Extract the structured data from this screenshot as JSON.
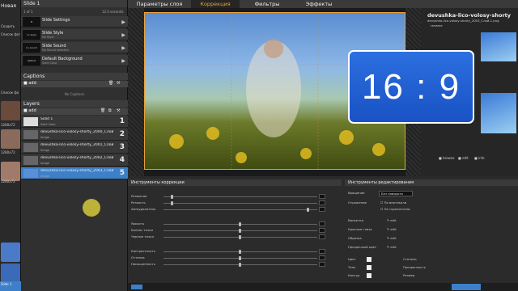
{
  "left_strip": {
    "items": [
      "Новая",
      "Создать",
      "Список фото",
      "Список фо"
    ],
    "thumb_labels": [
      "1280x72",
      "1280x72",
      "1280x72"
    ]
  },
  "slide_panel": {
    "title": "Slide 1",
    "count": "1 of 1",
    "duration": "12.0 seconds",
    "rows": [
      {
        "icon": "",
        "title": "Slide Settings",
        "sub": ""
      },
      {
        "icon": "no style",
        "title": "Slide Style",
        "sub": "No Style"
      },
      {
        "icon": "no sound",
        "title": "Slide Sound",
        "sub": "No Sound selected"
      },
      {
        "icon": "default",
        "title": "Default Background",
        "sub": "Solid Color"
      }
    ],
    "captions_label": "Captions",
    "add_label": "add",
    "no_captions": "No Captions",
    "layers_label": "Layers",
    "layers": [
      {
        "name": "Solid 1",
        "kind": "Solid Color",
        "num": "1"
      },
      {
        "name": "devushka-lico-volosy-shorty_2000_Слой-1.png",
        "kind": "Image",
        "num": "2"
      },
      {
        "name": "devushka-lico-volosy-shorty_2001_Слой-1.png",
        "kind": "Image",
        "num": "3"
      },
      {
        "name": "devushka-lico-volosy-shorty_2002_Слой-1.png",
        "kind": "Image",
        "num": "4"
      },
      {
        "name": "devushka-lico-volosy-shorty_2003_Слой-1.png",
        "kind": "Image",
        "num": "5"
      }
    ]
  },
  "tabs": [
    "Параметры слоя",
    "Коррекция",
    "Фильтры",
    "Эффекты"
  ],
  "props": {
    "title": "devushka-lico-volosy-shorty",
    "file": "devushka-lico-volosy-shorty_2003_Слой-1.png",
    "rename": "rename",
    "browse": "browse",
    "edit": "edit",
    "info": "info"
  },
  "banner": "16 : 9",
  "correction": {
    "title": "Инструменты коррекции",
    "sliders": [
      {
        "label": "Размытие",
        "pos": 0.05
      },
      {
        "label": "Резкость",
        "pos": 0.05
      },
      {
        "label": "Автоудалятель",
        "pos": 0.95
      },
      {
        "label": "Яркость",
        "pos": 0.5
      },
      {
        "label": "Баланс точки",
        "pos": 0.5
      },
      {
        "label": "Черные точки",
        "pos": 0.5
      },
      {
        "label": "Контрастность",
        "pos": 0.5
      },
      {
        "label": "Оттенок",
        "pos": 0.5
      },
      {
        "label": "Насыщенность",
        "pos": 0.5
      }
    ]
  },
  "editing": {
    "title": "Инструменты редактирования",
    "rotate": "Вращение",
    "rotate_val": "Без поворота",
    "flip": "Отражение",
    "flip_v": "По вертикали",
    "flip_h": "По горизонтали",
    "crop": "Виньетка",
    "red_eye": "Красные глаза",
    "straighten": "Обрезка",
    "transparent": "Прозрачный цвет",
    "edit": "edit",
    "color": "Цвет",
    "shadow": "Тень",
    "outline": "Контур",
    "softness": "Степень",
    "transparency": "Прозрачность",
    "size": "Размер"
  },
  "footer": {
    "slide": "Slide 1"
  }
}
